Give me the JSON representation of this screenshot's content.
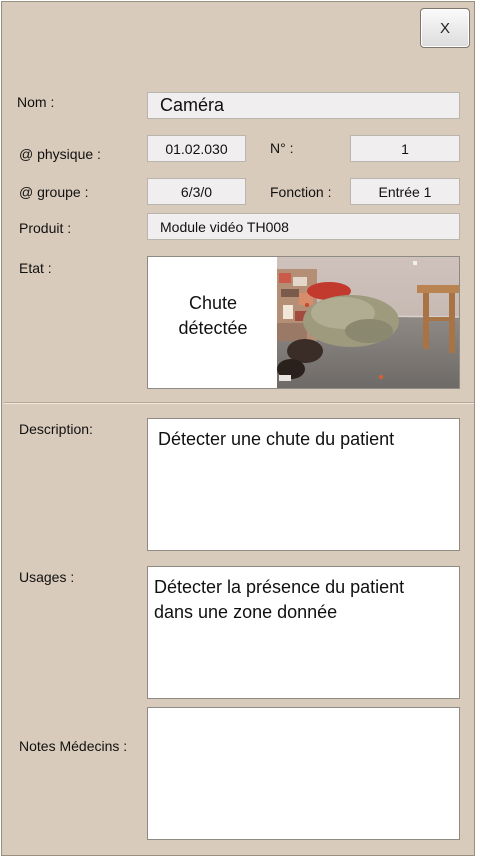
{
  "window": {
    "close_label": "X"
  },
  "labels": {
    "nom": "Nom :",
    "physique": "@ physique :",
    "numero": "N° :",
    "groupe": "@ groupe :",
    "fonction": "Fonction :",
    "produit": "Produit :",
    "etat": "Etat :",
    "description": "Description:",
    "usages": "Usages :",
    "notes": "Notes Médecins :"
  },
  "values": {
    "nom": "Caméra",
    "physique": "01.02.030",
    "numero": "1",
    "groupe": "6/3/0",
    "fonction": "Entrée 1",
    "produit": "Module vidéo TH008",
    "etat_text": "Chute\ndétectée",
    "description": "Détecter une chute du patient",
    "usages": "Détecter la présence du patient\ndans une zone donnée",
    "notes": ""
  },
  "icons": {
    "state_image": "camera-fall-photo"
  },
  "colors": {
    "window_bg": "#d9cbbb",
    "field_bg": "#f0eeee"
  }
}
